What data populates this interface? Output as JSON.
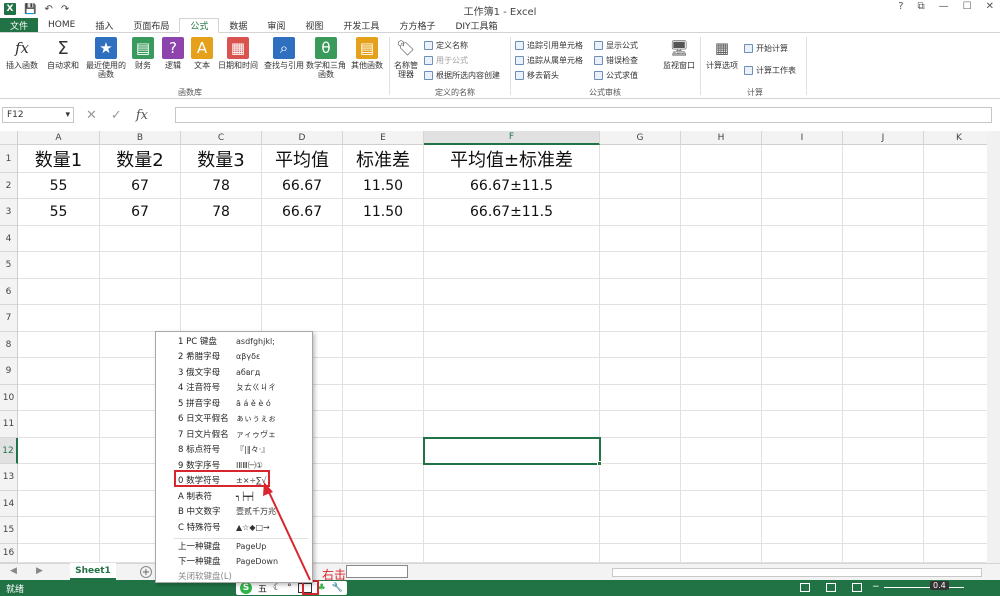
{
  "window": {
    "title": "工作簿1 - Excel",
    "logo": "X",
    "controls": [
      "?",
      "⧉",
      "—",
      "☐",
      "✕"
    ]
  },
  "ribbon_tabs": [
    "文件",
    "HOME",
    "插入",
    "页面布局",
    "公式",
    "数据",
    "审阅",
    "视图",
    "开发工具",
    "方方格子",
    "DIY工具箱"
  ],
  "active_tab": "公式",
  "ribbon": {
    "insert_function": "插入函数",
    "autosum": "自动求和",
    "recent": "最近使用的函数",
    "financial": "财务",
    "logical": "逻辑",
    "text": "文本",
    "datetime": "日期和时间",
    "lookup": "查找与引用",
    "math": "数学和三角函数",
    "more": "其他函数",
    "group_library": "函数库",
    "name_manager": "名称管理器",
    "define_name": "定义名称",
    "use_in_formula": "用于公式",
    "create_from_selection": "根据所选内容创建",
    "group_names": "定义的名称",
    "trace_precedents": "追踪引用单元格",
    "trace_dependents": "追踪从属单元格",
    "remove_arrows": "移去箭头",
    "show_formulas": "显示公式",
    "error_checking": "错误检查",
    "evaluate_formula": "公式求值",
    "watch_window": "监视窗口",
    "group_audit": "公式审核",
    "calc_options": "计算选项",
    "calc_now": "开始计算",
    "calc_sheet": "计算工作表",
    "group_calc": "计算"
  },
  "formula_bar": {
    "name_box": "F12",
    "fx": "fx"
  },
  "columns": [
    "A",
    "B",
    "C",
    "D",
    "E",
    "F",
    "G",
    "H",
    "I",
    "J",
    "K"
  ],
  "rows": [
    "1",
    "2",
    "3",
    "4",
    "5",
    "6",
    "7",
    "8",
    "9",
    "10",
    "11",
    "12",
    "13",
    "14",
    "15",
    "16"
  ],
  "table": {
    "headers": [
      "数量1",
      "数量2",
      "数量3",
      "平均值",
      "标准差",
      "平均值±标准差"
    ],
    "rows": [
      [
        "55",
        "67",
        "78",
        "66.67",
        "11.50",
        "66.67±11.5"
      ],
      [
        "55",
        "67",
        "78",
        "66.67",
        "11.50",
        "66.67±11.5"
      ]
    ]
  },
  "sheet_tab": "Sheet1",
  "status": {
    "ready": "就绪",
    "ime_char": "五",
    "zoom": "0.4"
  },
  "popup_menu": {
    "items": [
      {
        "label": "1 PC 键盘",
        "sample": "asdfghjkl;"
      },
      {
        "label": "2 希腊字母",
        "sample": "αβγδε"
      },
      {
        "label": "3 俄文字母",
        "sample": "абвгд"
      },
      {
        "label": "4 注音符号",
        "sample": "ㄆㄊㄍㄐㄔ"
      },
      {
        "label": "5 拼音字母",
        "sample": "ā á ě è ó"
      },
      {
        "label": "6 日文平假名",
        "sample": "ぁぃぅぇぉ"
      },
      {
        "label": "7 日文片假名",
        "sample": "ァィゥヴェ"
      },
      {
        "label": "8 标点符号",
        "sample": "『|‖々·』"
      },
      {
        "label": "9 数字序号",
        "sample": "ⅠⅡⅢ㈠①"
      },
      {
        "label": "0 数学符号",
        "sample": "±×÷∑√"
      },
      {
        "label": "A 制表符",
        "sample": "┑┝┯┥"
      },
      {
        "label": "B 中文数字",
        "sample": "壹贰千万兆"
      },
      {
        "label": "C 特殊符号",
        "sample": "▲☆◆□→"
      }
    ],
    "prev": {
      "label": "上一种键盘",
      "key": "PageUp"
    },
    "next": {
      "label": "下一种键盘",
      "key": "PageDown"
    },
    "close": "关闭软键盘(L)"
  },
  "annotation": "右击",
  "colors": {
    "excel_green": "#217346",
    "highlight_red": "#d9262e"
  }
}
